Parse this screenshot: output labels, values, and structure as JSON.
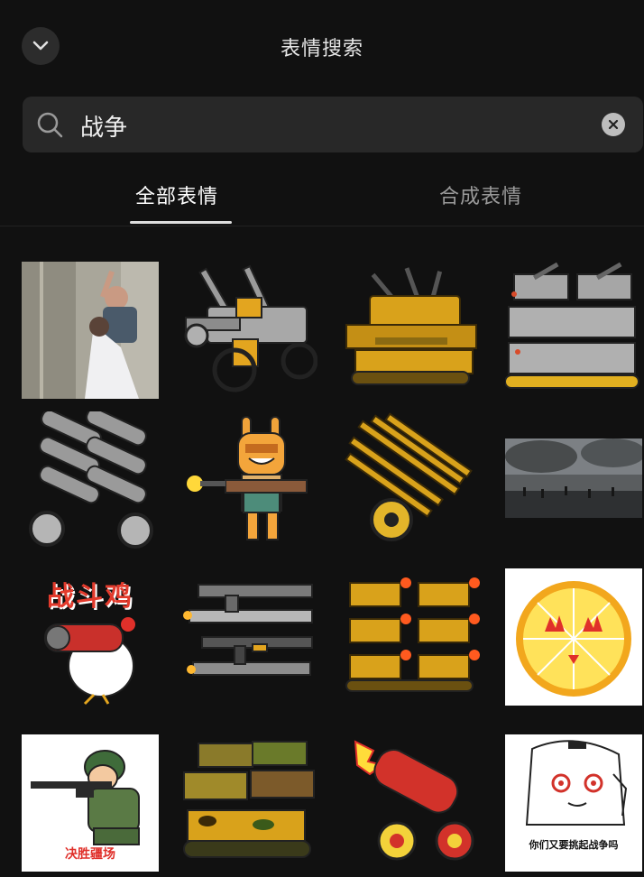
{
  "header": {
    "title": "表情搜索",
    "back_icon": "chevron-down-icon"
  },
  "search": {
    "query": "战争",
    "placeholder": "",
    "search_icon": "search-icon",
    "clear_icon": "clear-icon"
  },
  "tabs": [
    {
      "label": "全部表情",
      "active": true
    },
    {
      "label": "合成表情",
      "active": false
    }
  ],
  "results": [
    {
      "subject": "photo of people fighting"
    },
    {
      "subject": "grey anti-aircraft gun"
    },
    {
      "subject": "yellow anti-aircraft tank"
    },
    {
      "subject": "grey multi-turret tanks"
    },
    {
      "subject": "grey rocket launcher"
    },
    {
      "subject": "bunny character shooting rifle"
    },
    {
      "subject": "golden multi-barrel cannon"
    },
    {
      "subject": "battlefield smoke photo"
    },
    {
      "subject": "chicken with bazooka",
      "caption": "战斗鸡"
    },
    {
      "subject": "stacked guns"
    },
    {
      "subject": "golden cannons firing"
    },
    {
      "subject": "lemon face with fire eyes"
    },
    {
      "subject": "soldier aiming rifle",
      "caption": "决胜疆场"
    },
    {
      "subject": "camouflage tanks"
    },
    {
      "subject": "red cannon firing"
    },
    {
      "subject": "white hooded character",
      "caption": "你们又要挑起战争吗"
    }
  ],
  "colors": {
    "background": "#111111",
    "search_bg": "#282828",
    "accent_red": "#e0302a",
    "gold": "#d9a21b"
  }
}
